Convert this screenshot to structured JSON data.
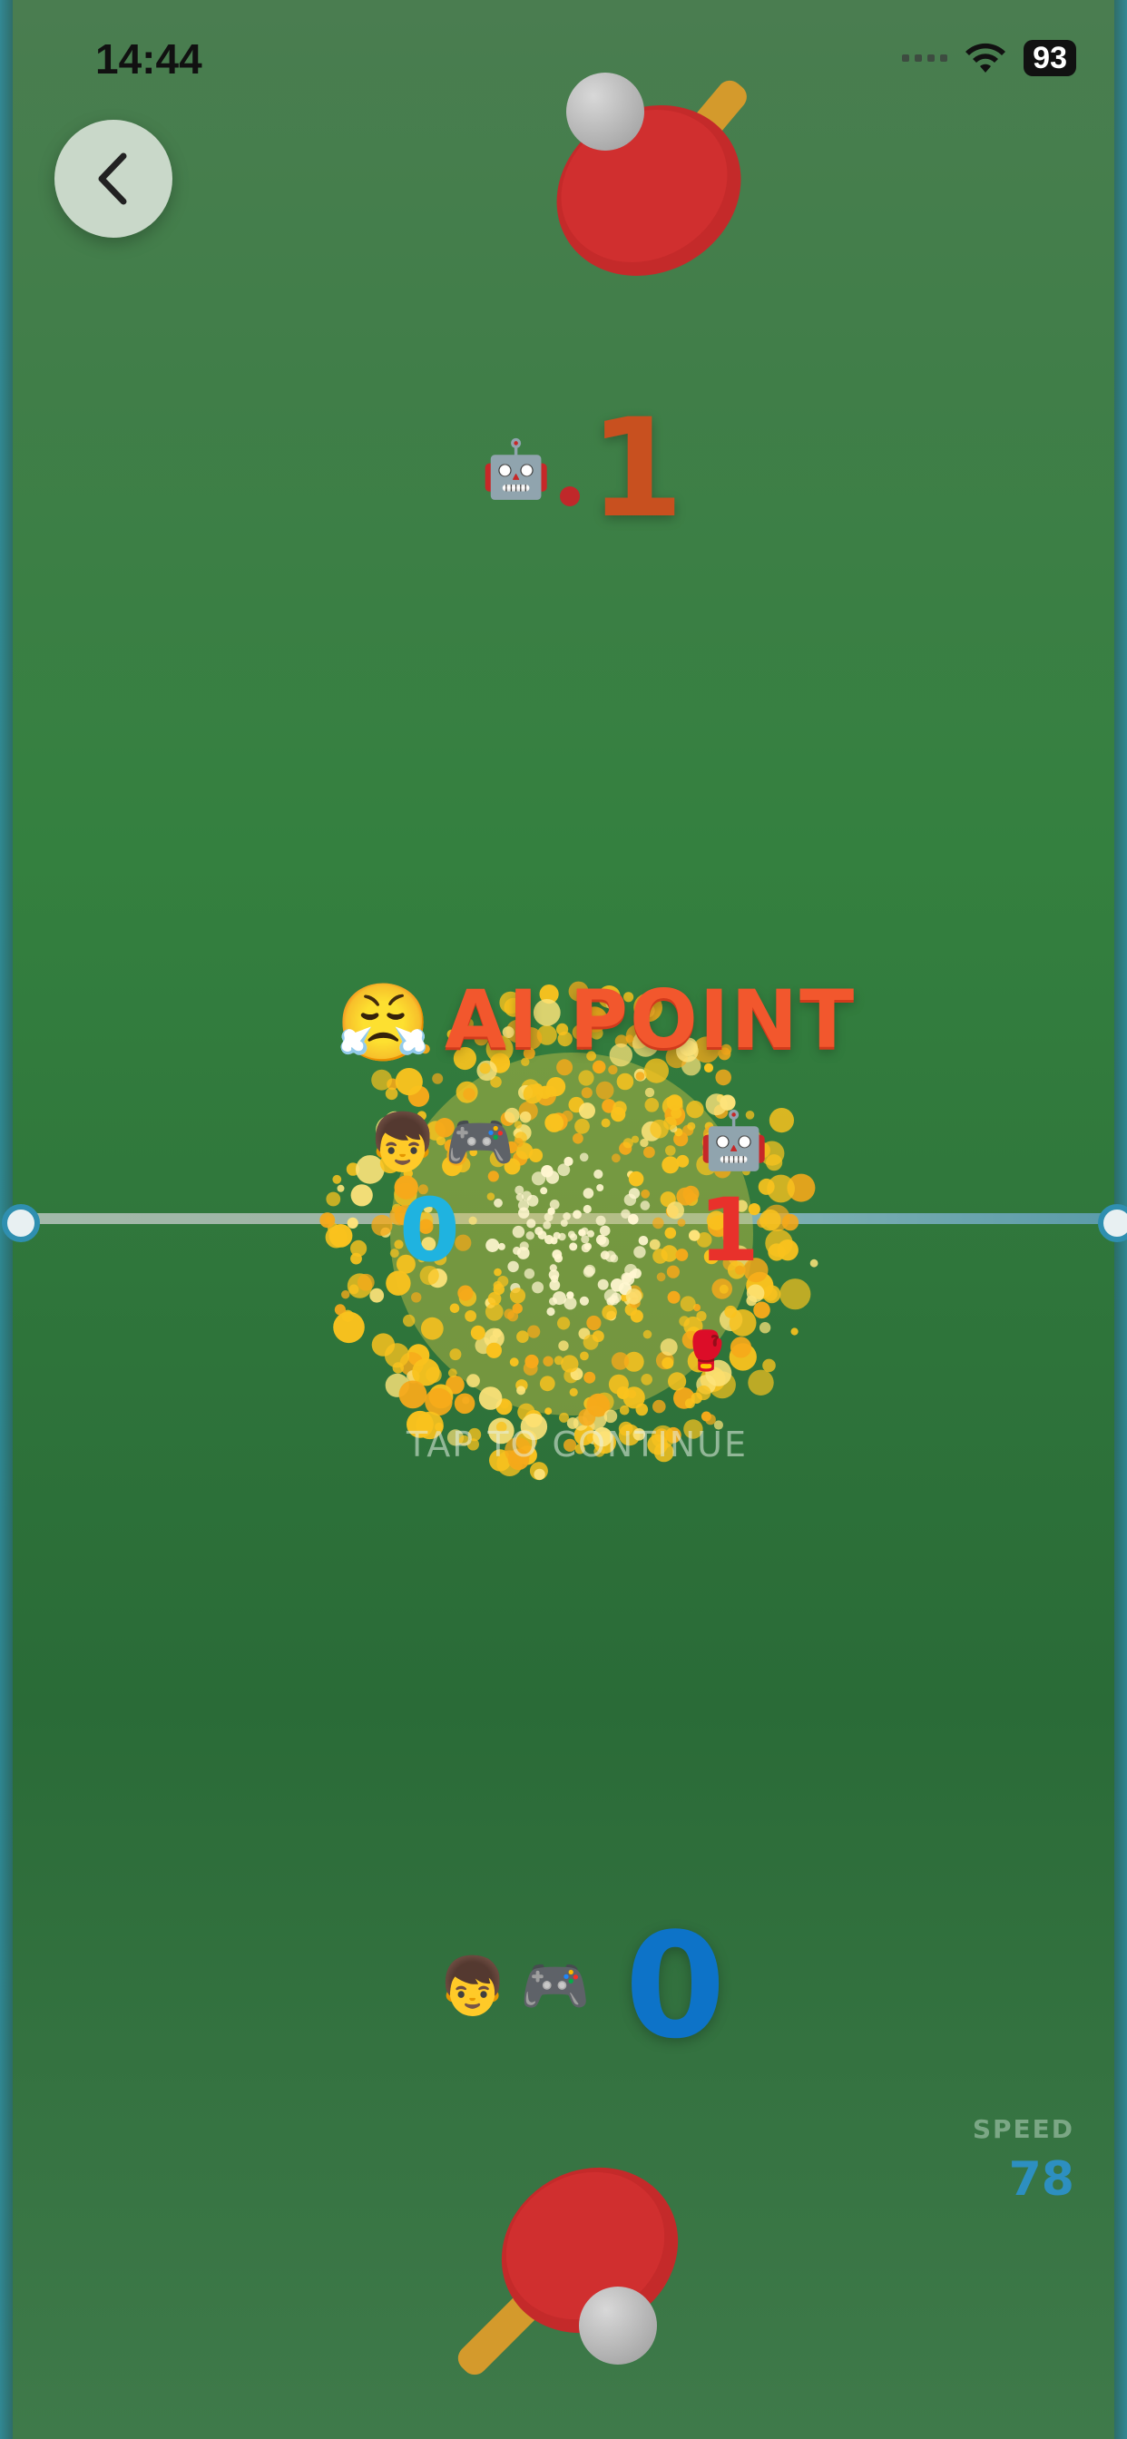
{
  "status_bar": {
    "time": "14:44",
    "battery": "93"
  },
  "top_opponent": {
    "label_emoji": "🤖",
    "score": "1"
  },
  "bottom_player": {
    "label_emojis": [
      "👦",
      "🎮"
    ],
    "score": "0"
  },
  "point_panel": {
    "reaction_emoji": "😤",
    "title": "AI POINT",
    "player_emojis": [
      "👦",
      "🎮"
    ],
    "player_score": "0",
    "ai_emoji": "🤖",
    "ai_score": "1",
    "hint": "TAP TO CONTINUE",
    "glove_emoji": "🥊"
  },
  "speed": {
    "label": "SPEED",
    "value": "78"
  },
  "colors": {
    "table_green": "#2d6f3b",
    "ai_red": "#e8312b",
    "player_blue": "#0d73c8",
    "burst_yellow": "#f6c21c",
    "title_orange": "#f2572d"
  }
}
